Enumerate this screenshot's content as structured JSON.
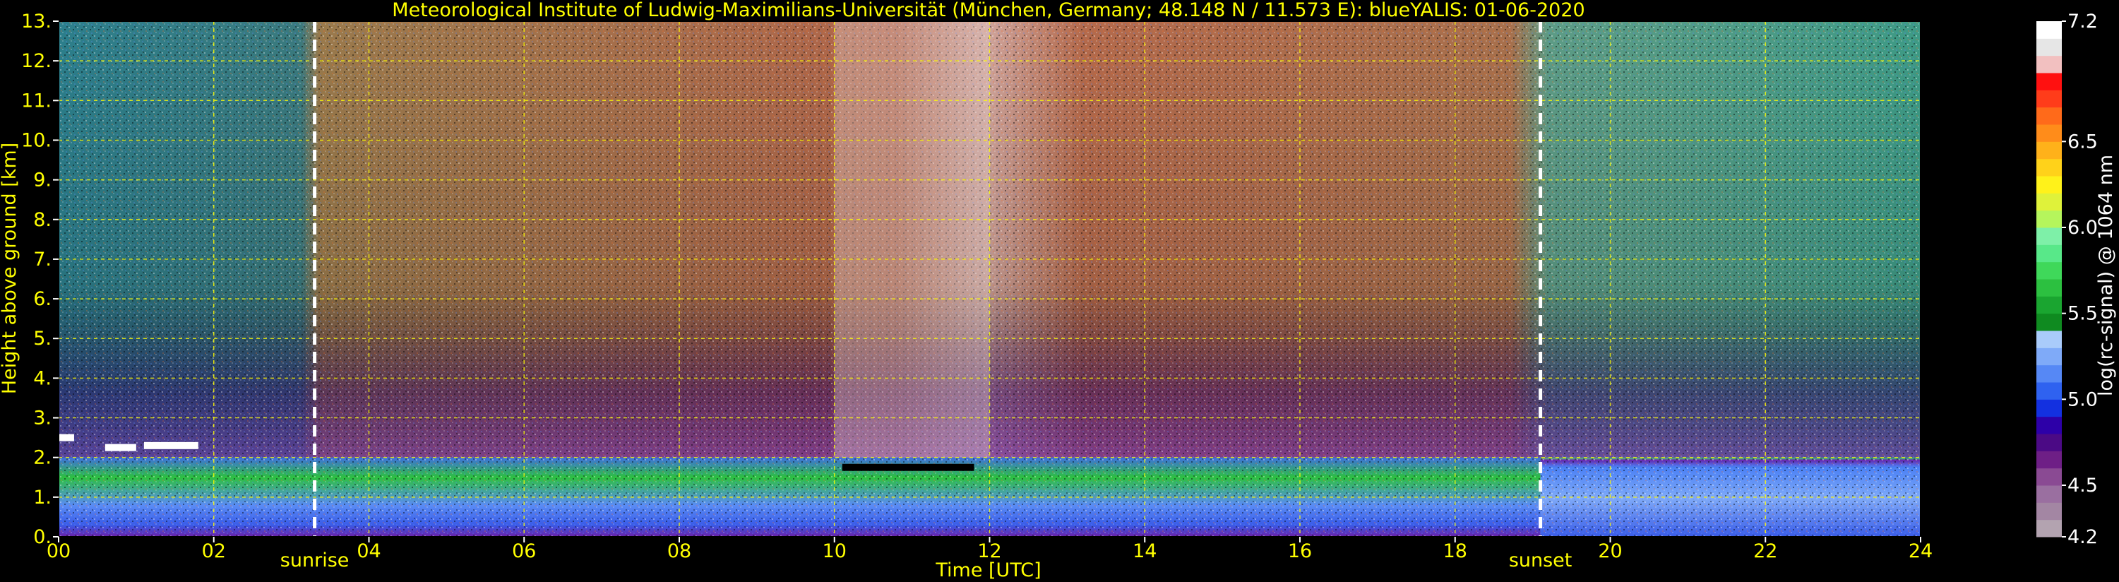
{
  "chart_data": {
    "type": "heatmap",
    "title": "Meteorological Institute of Ludwig-Maximilians-Universität (München, Germany; 48.148 N / 11.573 E):     blueYALIS: 01-06-2020",
    "xlabel": "Time [UTC]",
    "ylabel": "Height above ground [km]",
    "xlim": [
      0,
      24
    ],
    "ylim": [
      0,
      13
    ],
    "x_ticks": [
      0,
      2,
      4,
      6,
      8,
      10,
      12,
      14,
      16,
      18,
      20,
      22,
      24
    ],
    "x_tick_labels": [
      "00",
      "02",
      "04",
      "06",
      "08",
      "10",
      "12",
      "14",
      "16",
      "18",
      "20",
      "22",
      "24"
    ],
    "y_ticks": [
      0,
      1,
      2,
      3,
      4,
      5,
      6,
      7,
      8,
      9,
      10,
      11,
      12,
      13
    ],
    "y_tick_labels": [
      "0.",
      "1.",
      "2.",
      "3.",
      "4.",
      "5.",
      "6.",
      "7.",
      "8.",
      "9.",
      "10.",
      "11.",
      "12.",
      "13."
    ],
    "grid": true,
    "grid_color": "#ffff00",
    "annotations": [
      {
        "x": 3.3,
        "label": "sunrise"
      },
      {
        "x": 19.1,
        "label": "sunset"
      }
    ],
    "colorbar": {
      "label": "log(rc-signal) @ 1064 nm",
      "range": [
        4.2,
        7.2
      ],
      "tick_values": [
        4.2,
        4.5,
        5.0,
        5.5,
        6.0,
        6.5,
        7.2
      ],
      "tick_labels": [
        "4.2",
        "4.5",
        "5.0",
        "5.5",
        "6.0",
        "6.5",
        "7.2"
      ],
      "colors": [
        "#b3a3b0",
        "#a386a3",
        "#9a6fa0",
        "#8a4a93",
        "#6e1f86",
        "#4b0a85",
        "#2d00a8",
        "#1330e0",
        "#2f62f0",
        "#5688f5",
        "#7faaf8",
        "#a9cbfa",
        "#0f8a20",
        "#1aa530",
        "#2cc040",
        "#3fd85a",
        "#58e889",
        "#7ef0a8",
        "#b5f55c",
        "#dff23a",
        "#fff21a",
        "#ffd21a",
        "#ffb11a",
        "#ff8c1a",
        "#ff6a1a",
        "#ff3c1a",
        "#ff1010",
        "#f2c0c0",
        "#e6e6e6",
        "#ffffff"
      ]
    },
    "regions": [
      {
        "time_start": 0,
        "time_end": 3.3,
        "height_start": 3,
        "height_end": 13,
        "description_color": "#2c7f8c"
      },
      {
        "time_start": 3.3,
        "time_end": 19.1,
        "height_start": 2,
        "height_end": 13,
        "description_color": "#b06a4a"
      },
      {
        "time_start": 19.1,
        "time_end": 24,
        "height_start": 3,
        "height_end": 13,
        "description_color": "#3e9b86"
      },
      {
        "time_start": 0,
        "time_end": 24,
        "height_start": 0,
        "height_end": 2,
        "description_color": "#4a7cf0"
      }
    ],
    "clouds": [
      {
        "time_start": 0.0,
        "time_end": 0.2,
        "height": 2.5
      },
      {
        "time_start": 0.6,
        "time_end": 1.0,
        "height": 2.25
      },
      {
        "time_start": 1.1,
        "time_end": 1.8,
        "height": 2.3
      },
      {
        "time_start": 10.1,
        "time_end": 11.8,
        "height": 1.75
      }
    ]
  }
}
